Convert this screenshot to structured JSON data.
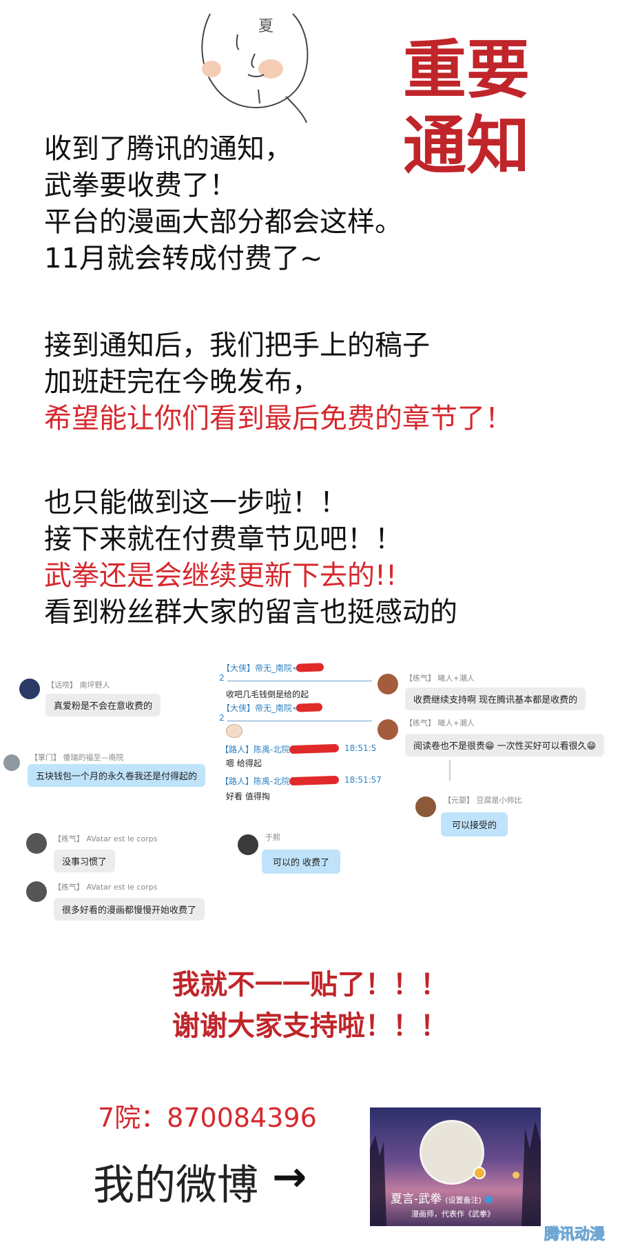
{
  "title": {
    "line1": "重要",
    "line2": "通知"
  },
  "doodle_text": "夏",
  "paragraphs": [
    {
      "lines": [
        "收到了腾讯的通知，",
        "武拳要收费了！",
        "平台的漫画大部分都会这样。",
        "11月就会转成付费了~"
      ]
    },
    {
      "lines": [
        "接到通知后，我们把手上的稿子",
        "加班赶完在今晚发布，"
      ],
      "red_line": "希望能让你们看到最后免费的章节了！"
    },
    {
      "lines": [
        "也只能做到这一步啦！！",
        "接下来就在付费章节见吧！！"
      ],
      "red_line": "武拳还是会继续更新下去的!!",
      "last_line": "看到粉丝群大家的留言也挺感动的"
    }
  ],
  "chats": {
    "left": [
      {
        "name": "【话唠】 南坪野人",
        "msg": "真爱粉是不会在意收费的"
      },
      {
        "name": "【掌门】 傻瑞的福至—南院",
        "msg": "五块钱包一个月的永久卷我还是付得起的"
      },
      {
        "name": "【练气】 AVatar est le corps",
        "msg": "没事习惯了"
      },
      {
        "name": "【练气】 AVatar est le corps",
        "msg": "很多好看的漫画都慢慢开始收费了"
      }
    ],
    "middle": {
      "lines": [
        {
          "tag": "【大侠】",
          "name": "帝无_南院<",
          "suffix": "2"
        },
        {
          "msg": "收吧几毛钱倒是给的起"
        },
        {
          "tag": "【大侠】",
          "name": "帝无_南院<",
          "suffix": "2"
        },
        {
          "tag": "【路人】",
          "name": "陈禹-北院(",
          "time": "18:51:5"
        },
        {
          "msg": "嗯 给得起"
        },
        {
          "tag": "【路人】",
          "name": "陈禹-北院(",
          "time": "18:51:57"
        },
        {
          "msg": "好看 值得掏"
        }
      ],
      "yu": {
        "name": "于熙",
        "msg": "可以的 收费了"
      }
    },
    "right": [
      {
        "name": "【练气】 曦人+潮人",
        "msg": "收费继续支持啊 现在腾讯基本都是收费的"
      },
      {
        "name": "【练气】 曦人+潮人",
        "msg": "阅读卷也不是很贵😁 一次性买好可以看很久😁"
      },
      {
        "name": "【元婴】 豆腐是小帅比",
        "msg": "可以接受的"
      }
    ]
  },
  "thanks": [
    "我就不一一贴了！！！",
    "谢谢大家支持啦！！！"
  ],
  "group_number": "7院：870084396",
  "weibo_label": "我的微博",
  "arrow": "→",
  "profile": {
    "name": "夏言-武拳",
    "remark": "(设置备注)",
    "desc": "漫画师，代表作《武拳》",
    "watermark": "腾讯动漫"
  },
  "colors": {
    "accent_red": "#c0252a",
    "bubble_blue": "#bfe3fa",
    "bubble_gray": "#ececec"
  }
}
